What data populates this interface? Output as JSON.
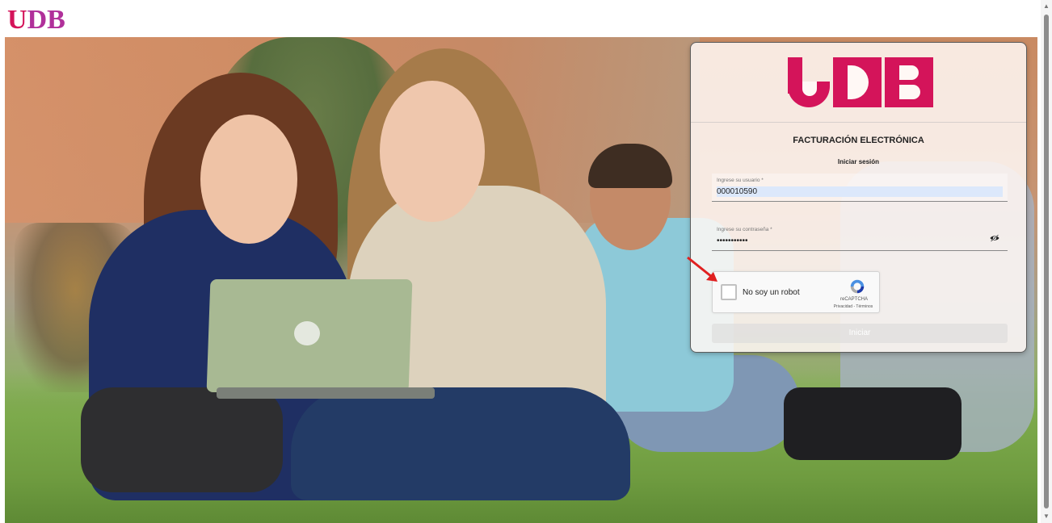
{
  "header": {
    "logo_text": "UDB",
    "logo_letters": [
      "U",
      "D",
      "B"
    ]
  },
  "card": {
    "logo_text": "UDB",
    "title": "FACTURACIÓN ELECTRÓNICA",
    "subtitle": "Iniciar sesión",
    "username": {
      "label": "Ingrese su usuario *",
      "value": "000010590"
    },
    "password": {
      "label": "Ingrese su contraseña *",
      "value": "•••••••••••"
    },
    "recaptcha": {
      "label": "No soy un robot",
      "brand": "reCAPTCHA",
      "links": "Privacidad - Términos"
    },
    "submit_label": "Iniciar"
  },
  "colors": {
    "brand": "#d4145a",
    "logo_top": "#b0309a",
    "arrow": "#e02020"
  },
  "icons": [
    "eye-off-icon",
    "recaptcha-logo-icon",
    "red-arrow-icon"
  ]
}
